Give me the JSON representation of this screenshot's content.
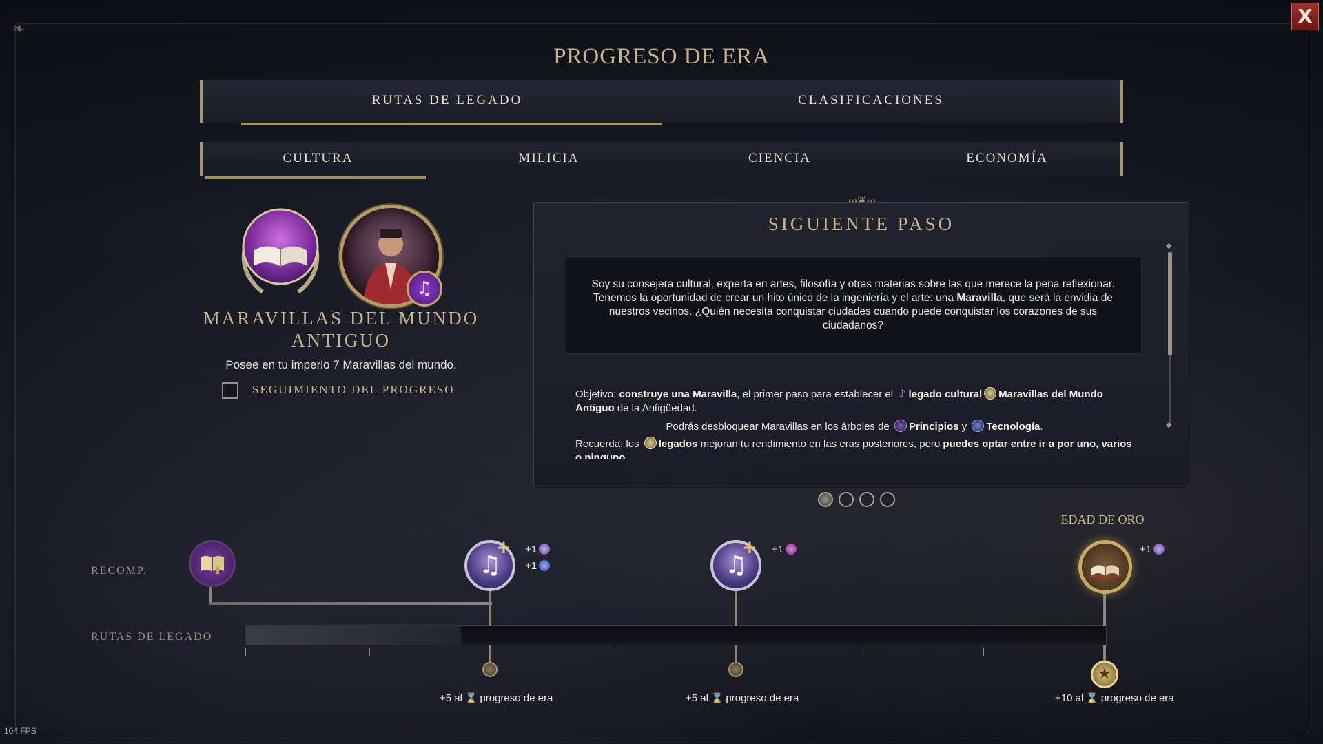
{
  "window": {
    "title": "PROGRESO DE ERA",
    "close_label": "X",
    "fps": "104 FPS"
  },
  "tabs": {
    "top": [
      "RUTAS DE LEGADO",
      "CLASIFICACIONES"
    ],
    "top_active": 0,
    "sub": [
      "CULTURA",
      "MILICIA",
      "CIENCIA",
      "ECONOMÍA"
    ],
    "sub_active": 0
  },
  "legacy": {
    "name_line1": "MARAVILLAS DEL MUNDO",
    "name_line2": "ANTIGUO",
    "description": "Posee en tu imperio 7 Maravillas del mundo.",
    "tracking_label": "SEGUIMIENTO DEL PROGRESO",
    "tracking_checked": false,
    "emblem_icon": "open-book-icon",
    "advisor_icon": "music-note-icon"
  },
  "next_step": {
    "title": "SIGUIENTE PASO",
    "quote_before": "Soy su consejera cultural, experta en artes, filosofía y otras materias sobre las que merece la pena reflexionar. Tenemos la oportunidad de crear un hito único de la ingeniería y el arte: una ",
    "quote_bold": "Maravilla",
    "quote_after": ", que será la envidia de nuestros vecinos. ¿Quién necesita conquistar ciudades cuando puede conquistar los corazones de sus ciudadanos?",
    "obj_prefix": "Objetivo: ",
    "obj_bold1": "construye una Maravilla",
    "obj_mid": ", el primer paso para establecer el ",
    "obj_bold2": "legado cultural",
    "obj_bold3": "Maravillas del Mundo Antiguo",
    "obj_suffix": " de la Antigüedad.",
    "unlock_prefix": "Podrás desbloquear Maravillas en los árboles de ",
    "unlock_civics": "Principios",
    "unlock_and": " y ",
    "unlock_tech": "Tecnología",
    "unlock_dot": ".",
    "remember_prefix": "Recuerda: los ",
    "remember_bold1": "legados",
    "remember_mid": " mejoran tu rendimiento en las eras posteriores, pero ",
    "remember_bold2": "puedes optar entre ir a por uno, varios o ninguno",
    "page_dots": 4,
    "page_active": 0
  },
  "rewards": {
    "row_label": "RECOMP.",
    "path_label": "RUTAS DE LEGADO",
    "golden_age_label": "EDAD DE ORO",
    "progress": 0.25,
    "nodes": [
      {
        "icon": "legacy-book-icon",
        "lines": []
      },
      {
        "icon": "music-note-icon",
        "lines": [
          "+1",
          "+1"
        ],
        "line_icons": [
          "civic-icon",
          "science-icon"
        ]
      },
      {
        "icon": "music-note-icon",
        "lines": [
          "+1"
        ],
        "line_icons": [
          "culture-icon"
        ]
      },
      {
        "icon": "golden-book-icon",
        "lines": [
          "+1"
        ],
        "line_icons": [
          "civic-icon"
        ]
      }
    ],
    "milestones": [
      {
        "amount": "+5 al",
        "label": "progreso de era"
      },
      {
        "amount": "+5 al",
        "label": "progreso de era"
      },
      {
        "amount": "+10 al",
        "label": "progreso de era"
      }
    ],
    "colors": {
      "accent_gold": "#c9b58c",
      "music_purple": "#8a3ac8"
    }
  }
}
